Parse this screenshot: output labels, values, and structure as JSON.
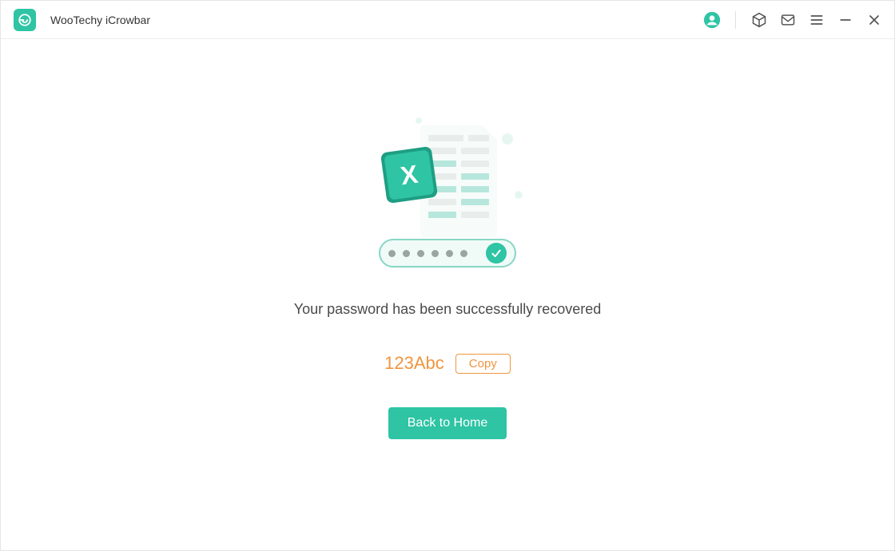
{
  "header": {
    "app_title": "WooTechy iCrowbar",
    "icons": {
      "account": "account-icon",
      "cube": "cube-icon",
      "mail": "mail-icon",
      "menu": "menu-icon",
      "minimize": "minimize-icon",
      "close": "close-icon"
    }
  },
  "main": {
    "status_message": "Your password has been successfully recovered",
    "recovered_password": "123Abc",
    "copy_label": "Copy",
    "home_label": "Back to Home",
    "illustration": {
      "file_type_badge": "X",
      "password_dots": 6,
      "check": true
    }
  },
  "colors": {
    "accent": "#2ec4a4",
    "highlight": "#f0953e"
  }
}
